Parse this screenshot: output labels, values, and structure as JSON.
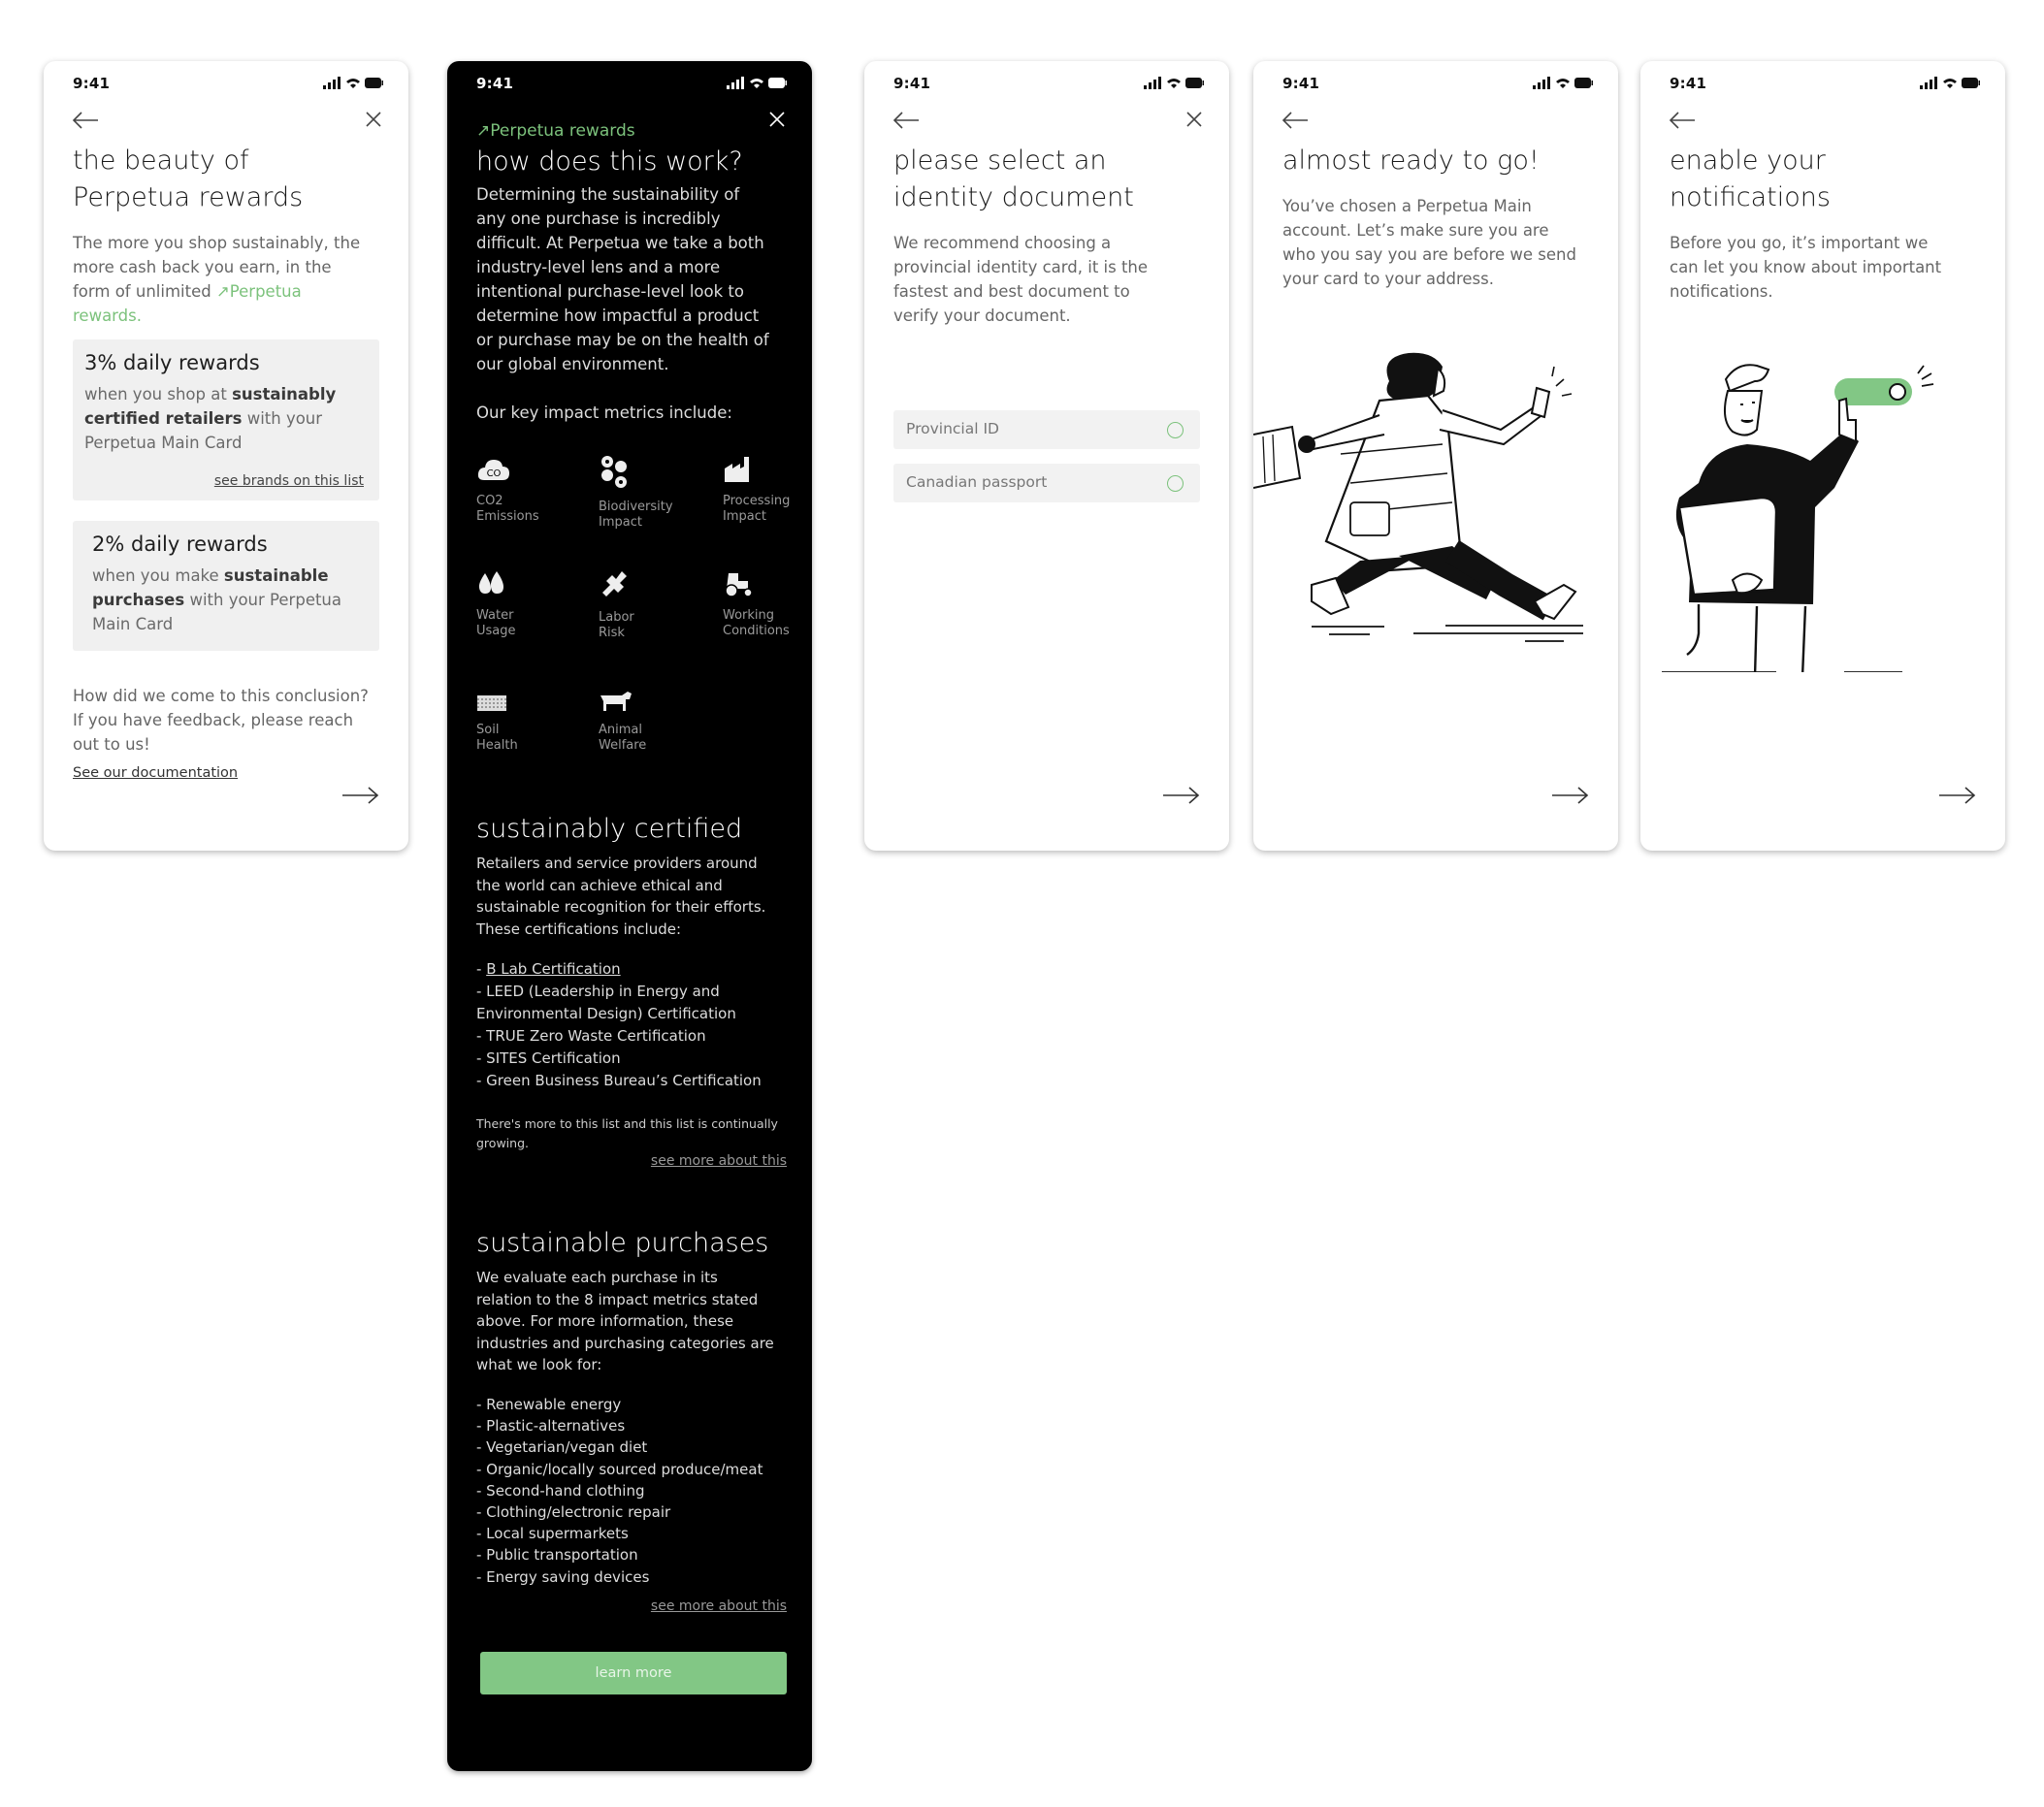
{
  "colors": {
    "accent": "#7cc27c",
    "dark_bg": "#000000",
    "card_bg": "#f0f0f0"
  },
  "status": {
    "time": "9:41"
  },
  "screen1": {
    "title": "the beauty of Perpetua rewards",
    "intro": "The more you shop sustainably, the more cash back you earn, in the form of unlimited",
    "intro_link": "Perpetua rewards.",
    "card1": {
      "title": "3% daily rewards",
      "t1": "when you shop at ",
      "bold": "sustainably certified retailers",
      "t2": " with your Perpetua Main Card",
      "link": "see brands on this list"
    },
    "card2": {
      "title": "2% daily rewards",
      "t1": "when you make ",
      "bold": "sustainable purchases",
      "t2": " with your Perpetua Main Card"
    },
    "feedback": "How did we come to this conclusion? If you have feedback, please reach out to us!",
    "doc_link": "See our documentation"
  },
  "screen2": {
    "kicker": "Perpetua rewards",
    "title": "how does this work?",
    "intro": "Determining the sustainability of any one purchase is incredibly difficult. At Perpetua we take a both industry-level lens and a more intentional purchase-level look to determine how impactful a product or purchase may be on the health of our global environment.",
    "metrics_heading": "Our key impact metrics include:",
    "metrics": [
      {
        "icon": "cloud-co2-icon",
        "line1": "CO2",
        "line2": "Emissions"
      },
      {
        "icon": "biodiversity-icon",
        "line1": "Biodiversity",
        "line2": "Impact"
      },
      {
        "icon": "factory-icon",
        "line1": "Processing",
        "line2": "Impact"
      },
      {
        "icon": "water-drops-icon",
        "line1": "Water",
        "line2": "Usage"
      },
      {
        "icon": "hand-tool-icon",
        "line1": "Labor",
        "line2": "Risk"
      },
      {
        "icon": "tractor-icon",
        "line1": "Working",
        "line2": "Conditions"
      },
      {
        "icon": "soil-icon",
        "line1": "Soil",
        "line2": "Health"
      },
      {
        "icon": "cow-icon",
        "line1": "Animal",
        "line2": "Welfare"
      }
    ],
    "certified_title": "sustainably certified",
    "certified_text": "Retailers and service providers around the world can achieve ethical and sustainable recognition for their efforts. These certifications include:",
    "cert_list_first_prefix": "- ",
    "cert_list_first_link": "B Lab Certification",
    "cert_list": [
      "- LEED (Leadership in Energy and Environmental Design) Certification",
      "- TRUE Zero Waste Certification",
      "- SITES Certification",
      "- Green Business Bureau’s Certification"
    ],
    "cert_note": "There's more to this list and this list is continually growing.",
    "see_more": "see more about this",
    "purchases_title": "sustainable purchases",
    "purchases_text": "We evaluate each purchase in its relation to the 8 impact metrics stated above. For more information, these industries and purchasing categories are what we look for:",
    "purchase_list": [
      "- Renewable energy",
      "- Plastic-alternatives",
      "- Vegetarian/vegan diet",
      "- Organic/locally sourced produce/meat",
      "- Second-hand clothing",
      "- Clothing/electronic repair",
      "- Local supermarkets",
      "- Public transportation",
      "- Energy saving devices"
    ],
    "see_more_2": "see more about this",
    "button": "learn more"
  },
  "screen3": {
    "title": "please select an identity document",
    "text": "We recommend choosing a provincial identity card, it is the fastest and best document to verify your document.",
    "options": [
      "Provincial ID",
      "Canadian passport"
    ]
  },
  "screen4": {
    "title": "almost ready to go!",
    "text": "You’ve chosen a Perpetua Main account. Let’s make sure you are who you say you are before we send your card to your address."
  },
  "screen5": {
    "title": "enable your notifications",
    "text": "Before you go, it’s important we can let you know about important notifications."
  }
}
